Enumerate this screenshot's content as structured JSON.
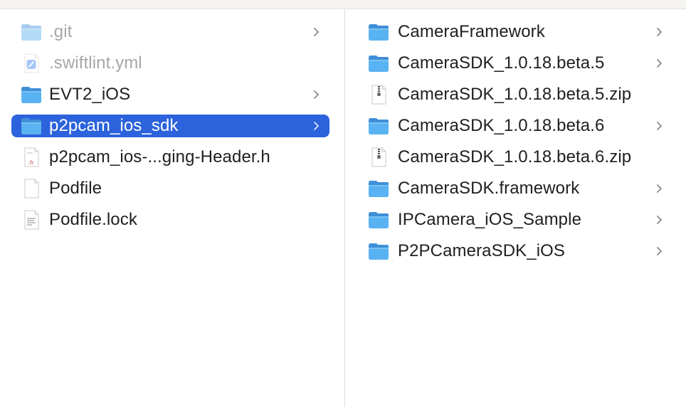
{
  "left_column": {
    "items": [
      {
        "name": ".git",
        "icon": "folder-icon",
        "has_children": true,
        "dim": true,
        "selected": false
      },
      {
        "name": ".swiftlint.yml",
        "icon": "swift-file-icon",
        "has_children": false,
        "dim": true,
        "selected": false
      },
      {
        "name": "EVT2_iOS",
        "icon": "folder-icon",
        "has_children": true,
        "dim": false,
        "selected": false
      },
      {
        "name": "p2pcam_ios_sdk",
        "icon": "folder-icon",
        "has_children": true,
        "dim": false,
        "selected": true
      },
      {
        "name": "p2pcam_ios-...ging-Header.h",
        "icon": "header-file-icon",
        "has_children": false,
        "dim": false,
        "selected": false
      },
      {
        "name": "Podfile",
        "icon": "blank-document-icon",
        "has_children": false,
        "dim": false,
        "selected": false
      },
      {
        "name": "Podfile.lock",
        "icon": "text-document-icon",
        "has_children": false,
        "dim": false,
        "selected": false
      }
    ]
  },
  "right_column": {
    "items": [
      {
        "name": "CameraFramework",
        "icon": "folder-icon",
        "has_children": true
      },
      {
        "name": "CameraSDK_1.0.18.beta.5",
        "icon": "folder-icon",
        "has_children": true
      },
      {
        "name": "CameraSDK_1.0.18.beta.5.zip",
        "icon": "zip-archive-icon",
        "has_children": false
      },
      {
        "name": "CameraSDK_1.0.18.beta.6",
        "icon": "folder-icon",
        "has_children": true
      },
      {
        "name": "CameraSDK_1.0.18.beta.6.zip",
        "icon": "zip-archive-icon",
        "has_children": false
      },
      {
        "name": "CameraSDK.framework",
        "icon": "folder-icon",
        "has_children": true
      },
      {
        "name": "IPCamera_iOS_Sample",
        "icon": "folder-icon",
        "has_children": true
      },
      {
        "name": "P2PCameraSDK_iOS",
        "icon": "folder-icon",
        "has_children": true
      }
    ]
  },
  "colors": {
    "selection": "#2c63dc",
    "folder_blue": "#59b2f1",
    "text": "#1f1f1f",
    "dim_text": "#a7a7a7"
  }
}
